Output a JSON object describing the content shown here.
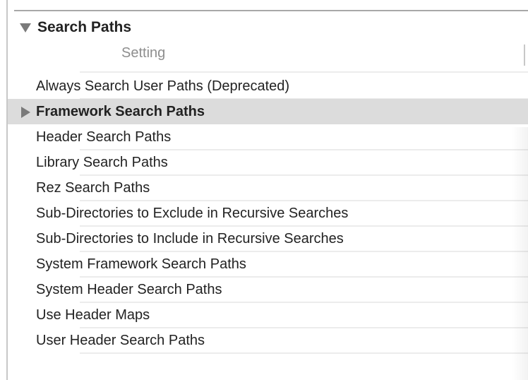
{
  "section": {
    "title": "Search Paths",
    "expanded": true
  },
  "table": {
    "column_header": "Setting",
    "rows": [
      {
        "label": "Always Search User Paths (Deprecated)"
      },
      {
        "label": "Framework Search Paths",
        "selected": true,
        "expandable": true
      },
      {
        "label": "Header Search Paths"
      },
      {
        "label": "Library Search Paths"
      },
      {
        "label": "Rez Search Paths"
      },
      {
        "label": "Sub-Directories to Exclude in Recursive Searches"
      },
      {
        "label": "Sub-Directories to Include in Recursive Searches"
      },
      {
        "label": "System Framework Search Paths"
      },
      {
        "label": "System Header Search Paths"
      },
      {
        "label": "Use Header Maps"
      },
      {
        "label": "User Header Search Paths"
      }
    ]
  }
}
